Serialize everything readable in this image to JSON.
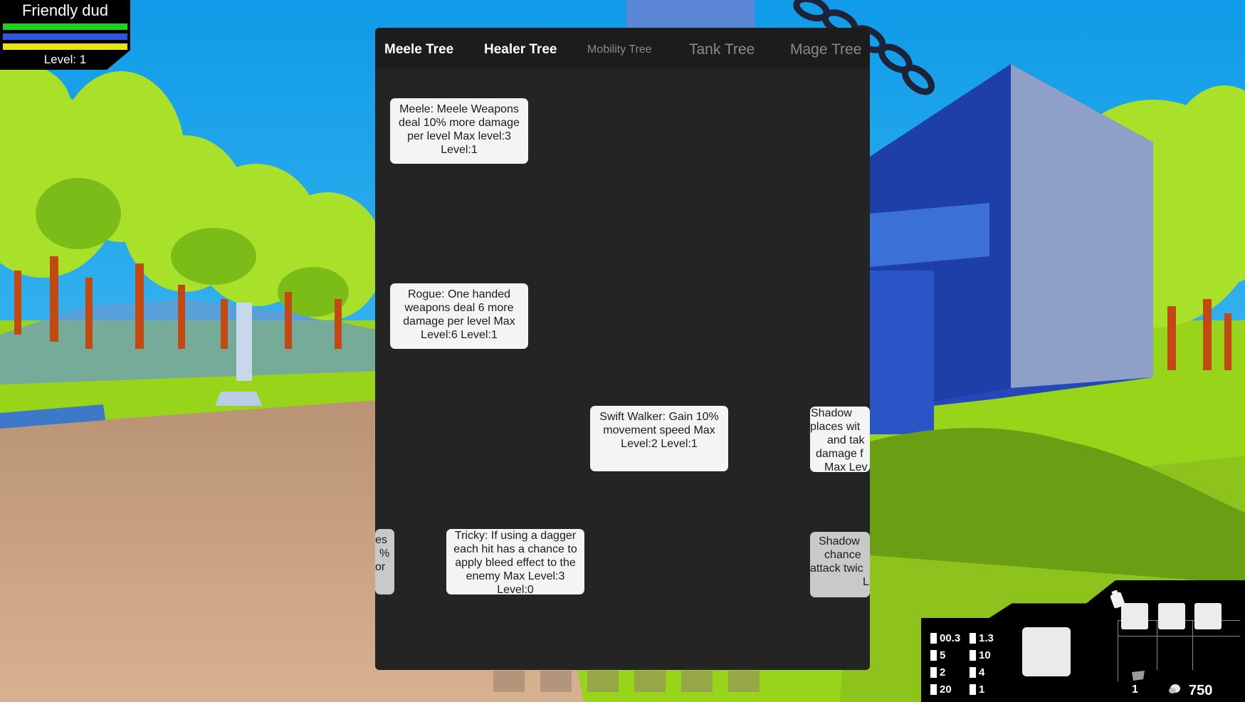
{
  "player": {
    "name": "Friendly dud",
    "level_label": "Level: 1",
    "bars": {
      "health": {
        "color": "#1fd11f",
        "fill": 1.0
      },
      "mana": {
        "color": "#2a56e0",
        "fill": 1.0
      },
      "stamina": {
        "color": "#e7e21c",
        "fill": 1.0
      }
    }
  },
  "skill_tree": {
    "tabs": [
      {
        "label": "Meele Tree",
        "active": true
      },
      {
        "label": "Healer Tree",
        "active": true
      },
      {
        "label": "Mobility Tree",
        "active": false
      },
      {
        "label": "Tank Tree",
        "active": false
      },
      {
        "label": "Mage Tree",
        "active": false
      }
    ],
    "skills": {
      "meele": "Meele: Meele Weapons deal 10% more damage per level Max level:3 Level:1",
      "rogue": "Rogue: One handed weapons deal 6 more damage per level Max Level:6  Level:1",
      "swift_walker": "Swift Walker: Gain 10% movement speed Max Level:2 Level:1",
      "tricky": "Tricky: If using a dagger each hit has a chance to apply bleed effect to the enemy Max Level:3 Level:0",
      "shadow_1_lines": [
        "Shadow",
        "places wit",
        "and tak",
        "damage f",
        "Max Lev"
      ],
      "shadow_2_lines": [
        "Shadow",
        "chance",
        "attack twic",
        "L"
      ],
      "partial_lines": [
        "es",
        "%",
        "or"
      ]
    }
  },
  "hud": {
    "stats": [
      {
        "value": "00.3"
      },
      {
        "value": "1.3"
      },
      {
        "value": "5"
      },
      {
        "value": "10"
      },
      {
        "value": "2"
      },
      {
        "value": "4"
      },
      {
        "value": "20"
      },
      {
        "value": "1"
      }
    ],
    "gem_count": "1",
    "coin_count": "750",
    "icons": {
      "gear": "gear-icon",
      "gem": "gem-icon",
      "coin": "coin-icon"
    }
  }
}
